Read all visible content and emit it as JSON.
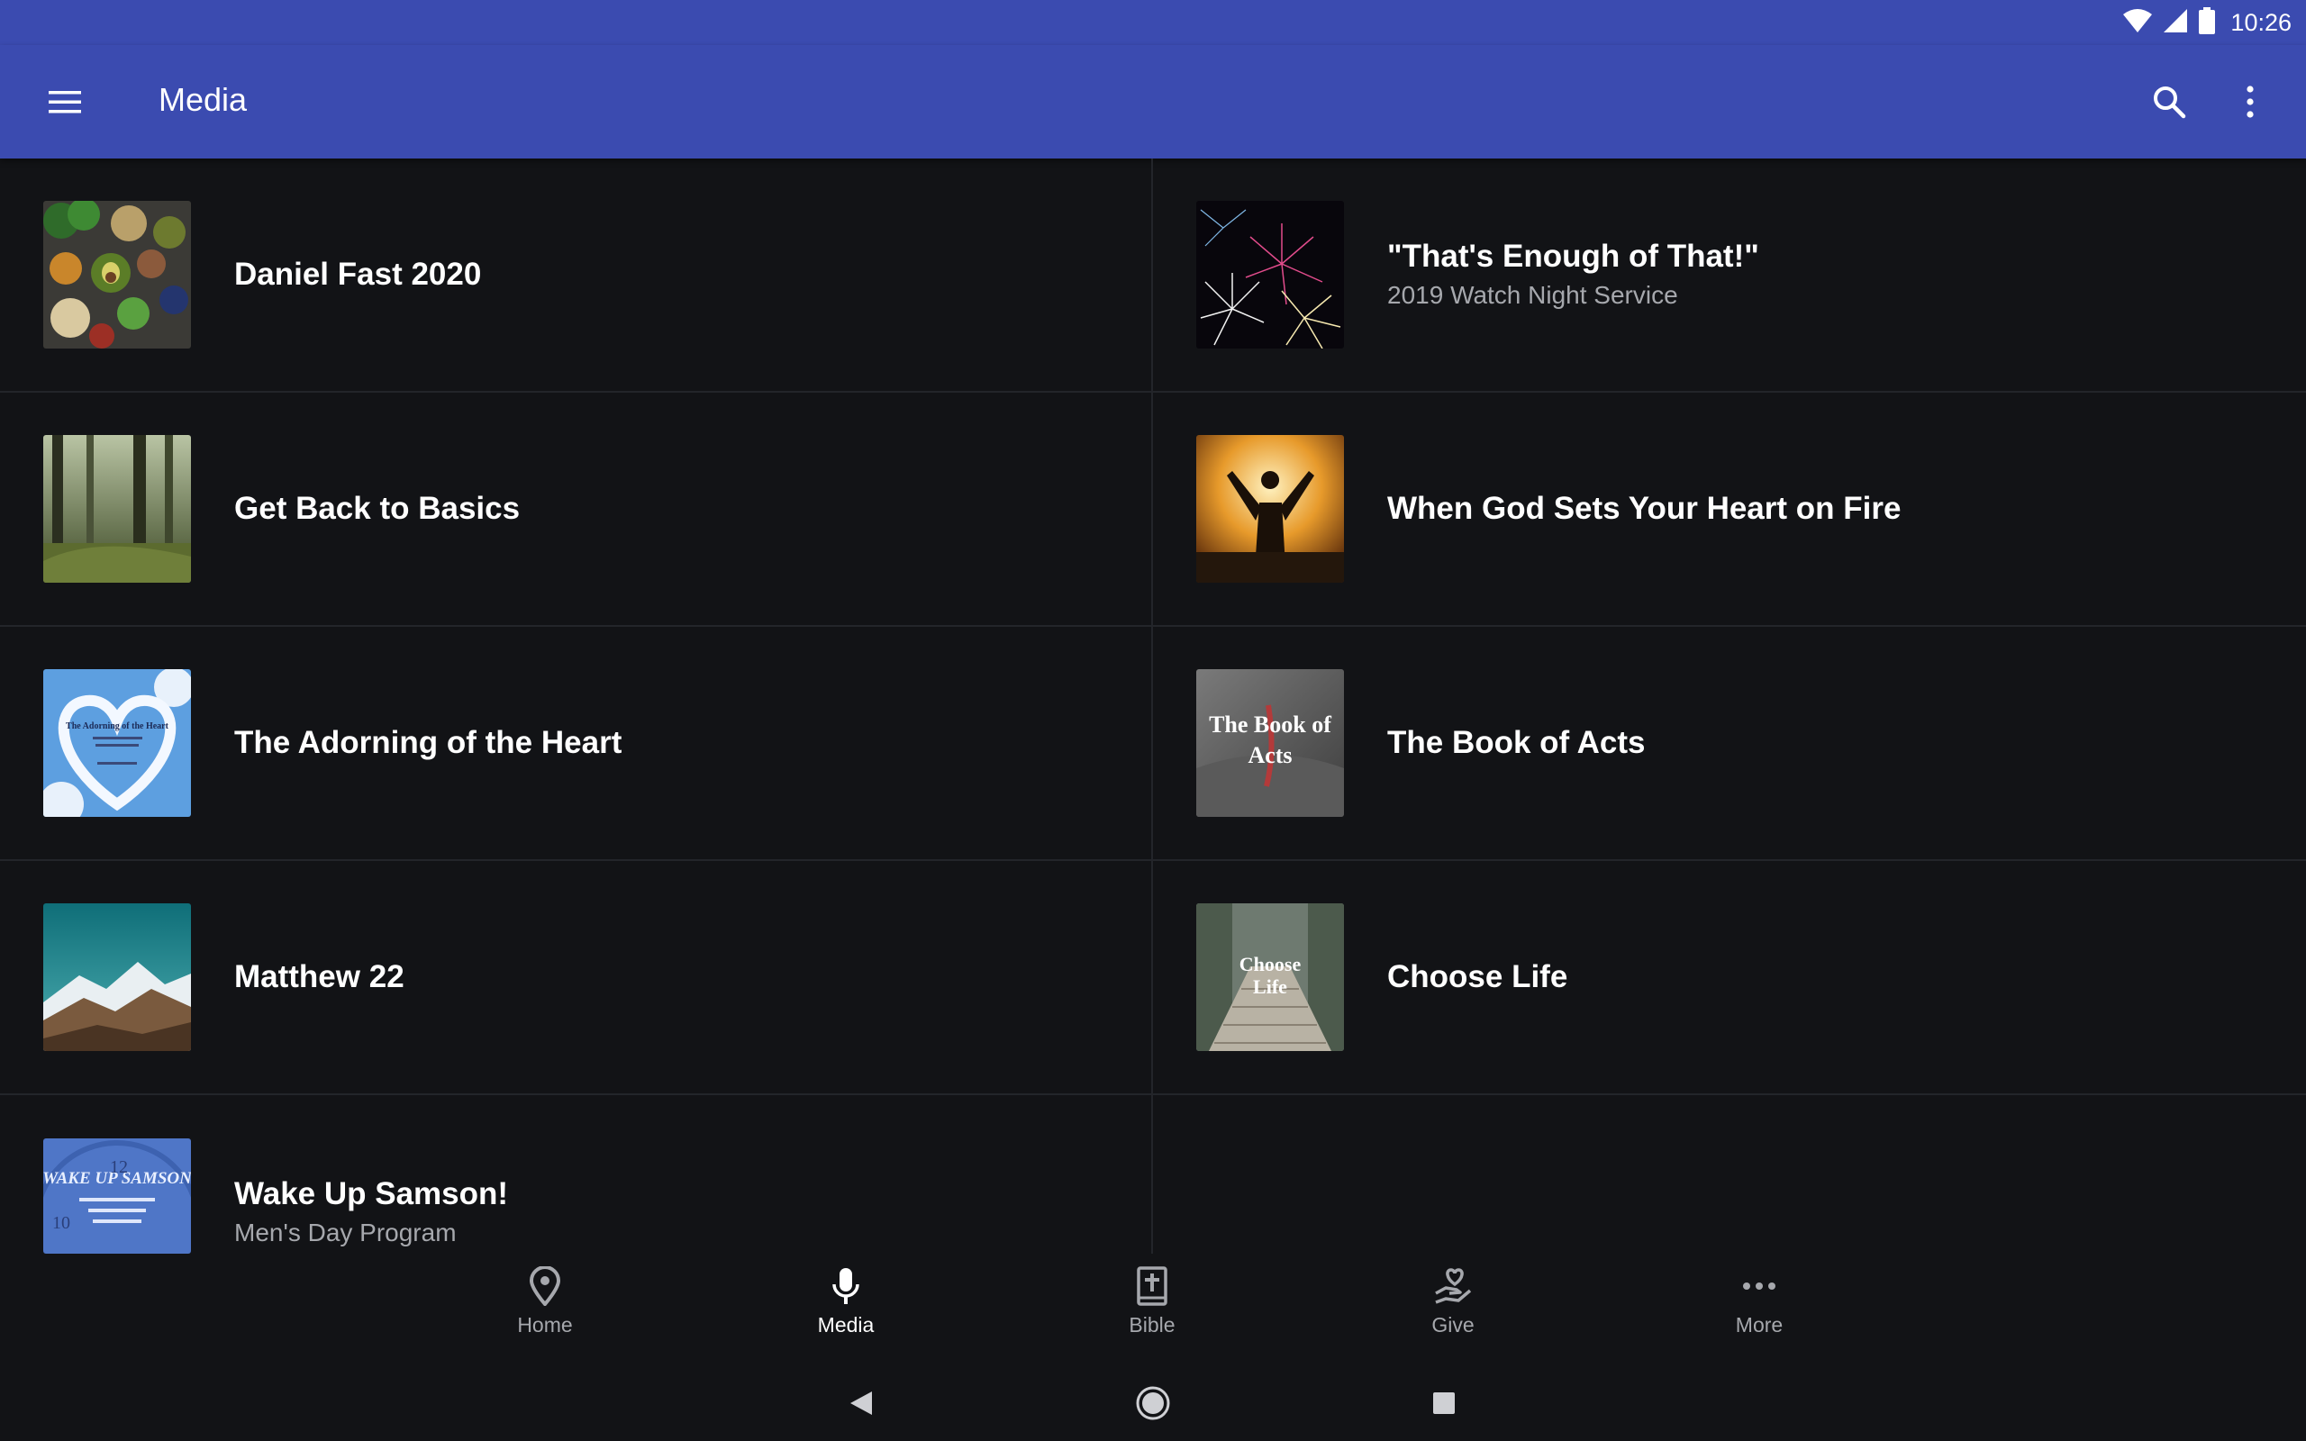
{
  "status_bar": {
    "time": "10:26",
    "icons": [
      "wifi-icon",
      "cell-signal-icon",
      "battery-icon"
    ]
  },
  "app_bar": {
    "title": "Media",
    "left_icon": "hamburger-menu-icon",
    "right_icons": [
      "search-icon",
      "more-vert-icon"
    ]
  },
  "media_items": [
    {
      "title": "Daniel Fast 2020",
      "subtitle": "",
      "thumb": "vegetables"
    },
    {
      "title": "\"That's Enough of That!\"",
      "subtitle": "2019 Watch Night Service",
      "thumb": "fireworks"
    },
    {
      "title": "Get Back to Basics",
      "subtitle": "",
      "thumb": "forest"
    },
    {
      "title": "When God Sets Your Heart on Fire",
      "subtitle": "",
      "thumb": "fire-worship"
    },
    {
      "title": "The Adorning of the Heart",
      "subtitle": "",
      "thumb": "cloud-heart",
      "thumb_text": "The Adorning of the Heart"
    },
    {
      "title": "The Book of Acts",
      "subtitle": "",
      "thumb": "book",
      "thumb_text": "The Book of Acts"
    },
    {
      "title": "Matthew 22",
      "subtitle": "",
      "thumb": "mountains"
    },
    {
      "title": "Choose Life",
      "subtitle": "",
      "thumb": "bridge",
      "thumb_text": "Choose Life"
    },
    {
      "title": "Wake Up Samson!",
      "subtitle": "Men's Day Program",
      "thumb": "clock",
      "thumb_text": "WAKE UP SAMSON"
    }
  ],
  "bottom_nav": [
    {
      "label": "Home",
      "icon": "location-pin-icon",
      "active": false
    },
    {
      "label": "Media",
      "icon": "microphone-icon",
      "active": true
    },
    {
      "label": "Bible",
      "icon": "bible-icon",
      "active": false
    },
    {
      "label": "Give",
      "icon": "give-heart-hand-icon",
      "active": false
    },
    {
      "label": "More",
      "icon": "more-horiz-icon",
      "active": false
    }
  ],
  "system_nav": [
    "back-icon",
    "home-icon",
    "recents-icon"
  ],
  "colors": {
    "app_bar": "#3b4bb0",
    "background": "#121316",
    "divider": "#23252a",
    "subtitle": "#a6a8ad"
  }
}
